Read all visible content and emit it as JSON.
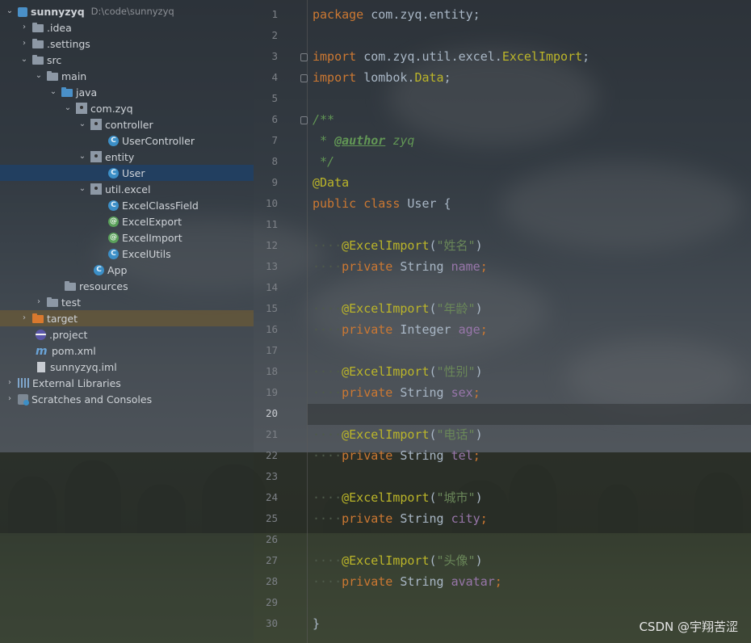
{
  "project_tree": {
    "root": {
      "label": "sunnyzyq",
      "path": "D:\\code\\sunnyzyq"
    },
    "items": [
      {
        "label": "sunnyzyq"
      },
      {
        "label": ".idea"
      },
      {
        "label": ".settings"
      },
      {
        "label": "src"
      },
      {
        "label": "main"
      },
      {
        "label": "java"
      },
      {
        "label": "com.zyq"
      },
      {
        "label": "controller"
      },
      {
        "label": "UserController",
        "icon_letter": "C"
      },
      {
        "label": "entity"
      },
      {
        "label": "User",
        "icon_letter": "C"
      },
      {
        "label": "util.excel"
      },
      {
        "label": "ExcelClassField",
        "icon_letter": "C"
      },
      {
        "label": "ExcelExport",
        "icon_letter": "@"
      },
      {
        "label": "ExcelImport",
        "icon_letter": "@"
      },
      {
        "label": "ExcelUtils",
        "icon_letter": "C"
      },
      {
        "label": "App",
        "icon_letter": "C"
      },
      {
        "label": "resources"
      },
      {
        "label": "test"
      },
      {
        "label": "target"
      },
      {
        "label": ".project"
      },
      {
        "label": "pom.xml",
        "icon_letter": "m"
      },
      {
        "label": "sunnyzyq.iml"
      },
      {
        "label": "External Libraries"
      },
      {
        "label": "Scratches and Consoles"
      }
    ]
  },
  "editor": {
    "line_numbers": [
      "1",
      "2",
      "3",
      "4",
      "5",
      "6",
      "7",
      "8",
      "9",
      "10",
      "11",
      "12",
      "13",
      "14",
      "15",
      "16",
      "17",
      "18",
      "19",
      "20",
      "21",
      "22",
      "23",
      "24",
      "25",
      "26",
      "27",
      "28",
      "29",
      "30"
    ],
    "current_line": "20",
    "code": {
      "pkg_kw": "package",
      "pkg_name": " com.zyq.entity;",
      "imp1_kw": "import",
      "imp1_pre": " com.zyq.util.excel.",
      "imp1_cls": "ExcelImport",
      "imp1_end": ";",
      "imp2_kw": "import",
      "imp2_pre": " lombok.",
      "imp2_cls": "Data",
      "imp2_end": ";",
      "doc_open": "/**",
      "doc_star": " * ",
      "doc_tag": "@author",
      "doc_val": " zyq",
      "doc_close": " */",
      "data_ann": "@Data",
      "cls_kw1": "public",
      "cls_kw2": "class",
      "cls_name": " User {",
      "indent": "····",
      "ann_name": "@ExcelImport",
      "private_kw": "private",
      "fields": [
        {
          "label": "\"姓名\"",
          "type": "String",
          "name": "name"
        },
        {
          "label": "\"年龄\"",
          "type": "Integer",
          "name": "age"
        },
        {
          "label": "\"性别\"",
          "type": "String",
          "name": "sex"
        },
        {
          "label": "\"电话\"",
          "type": "String",
          "name": "tel"
        },
        {
          "label": "\"城市\"",
          "type": "String",
          "name": "city"
        },
        {
          "label": "\"头像\"",
          "type": "String",
          "name": "avatar"
        }
      ],
      "close_brace": "}"
    }
  },
  "watermark": "CSDN @宇翔苦涩"
}
